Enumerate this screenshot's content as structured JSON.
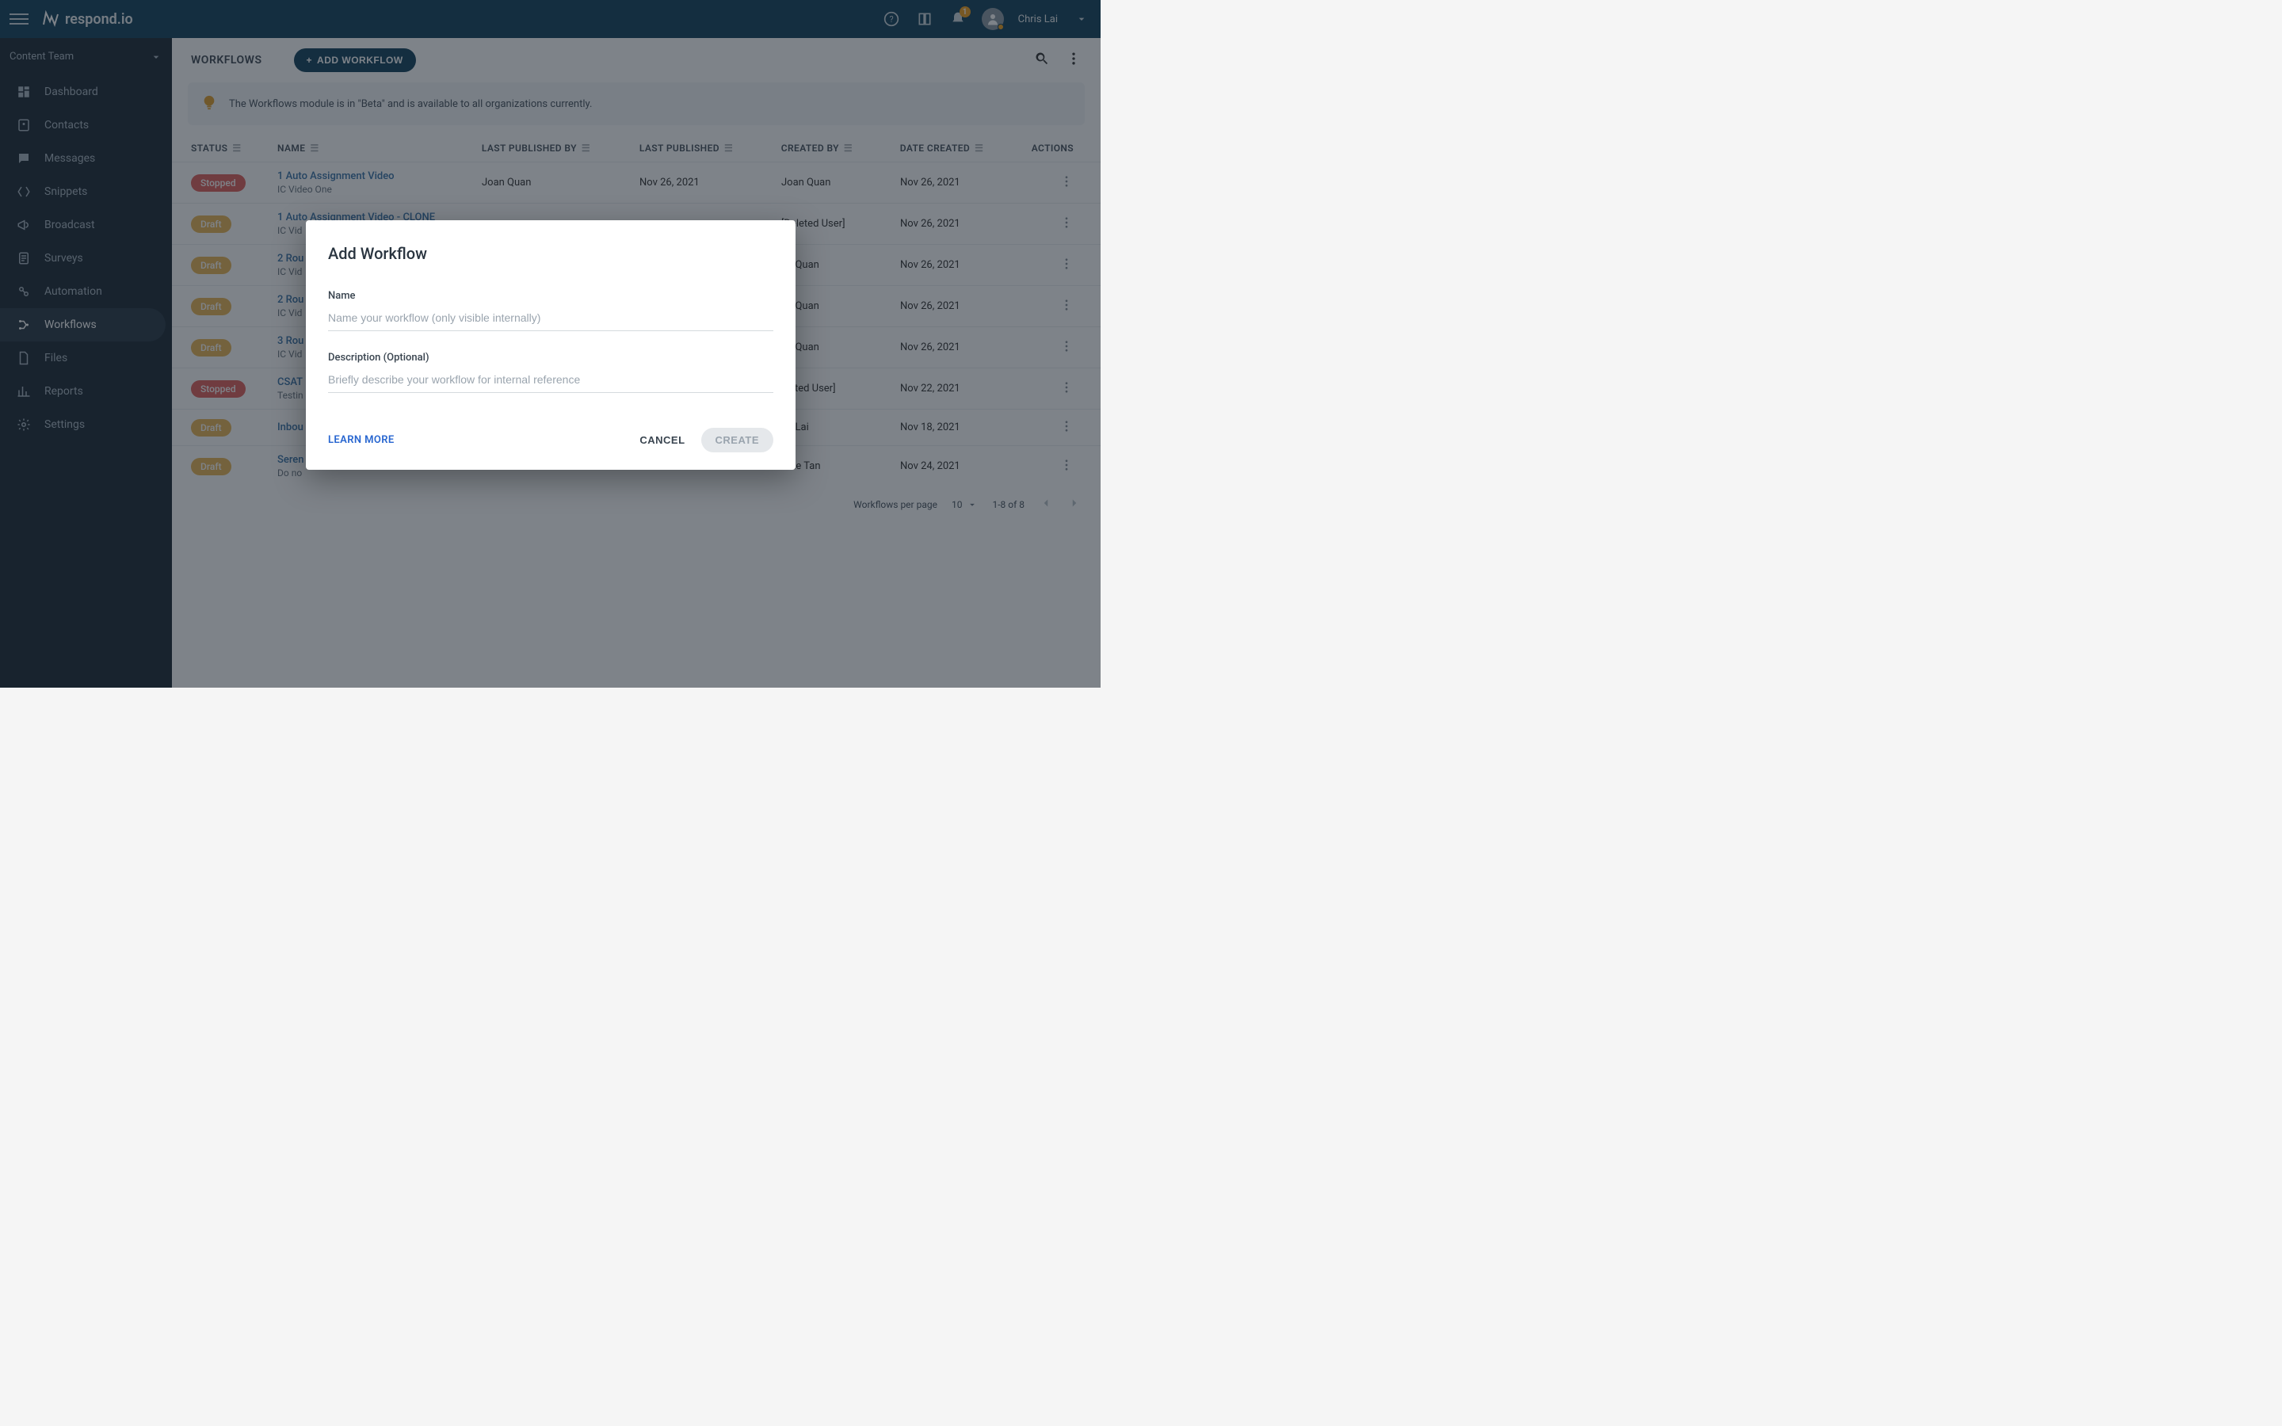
{
  "header": {
    "brand": "respond.io",
    "notif_count": "1",
    "username": "Chris Lai"
  },
  "sidebar": {
    "team": "Content Team",
    "items": [
      {
        "label": "Dashboard",
        "icon": "dashboard-icon"
      },
      {
        "label": "Contacts",
        "icon": "contacts-icon"
      },
      {
        "label": "Messages",
        "icon": "messages-icon"
      },
      {
        "label": "Snippets",
        "icon": "snippets-icon"
      },
      {
        "label": "Broadcast",
        "icon": "broadcast-icon"
      },
      {
        "label": "Surveys",
        "icon": "surveys-icon"
      },
      {
        "label": "Automation",
        "icon": "automation-icon"
      },
      {
        "label": "Workflows",
        "icon": "workflows-icon"
      },
      {
        "label": "Files",
        "icon": "files-icon"
      },
      {
        "label": "Reports",
        "icon": "reports-icon"
      },
      {
        "label": "Settings",
        "icon": "settings-icon"
      }
    ]
  },
  "page": {
    "title": "WORKFLOWS",
    "add_btn": "ADD WORKFLOW",
    "banner": "The Workflows module is in \"Beta\" and is available to all organizations currently."
  },
  "table": {
    "headers": {
      "status": "STATUS",
      "name": "NAME",
      "last_published_by": "LAST PUBLISHED BY",
      "last_published": "LAST PUBLISHED",
      "created_by": "CREATED BY",
      "date_created": "DATE CREATED",
      "actions": "ACTIONS"
    },
    "rows": [
      {
        "status": "Stopped",
        "status_class": "stopped",
        "name": "1 Auto Assignment Video",
        "sub": "IC Video One",
        "pub_by": "Joan Quan",
        "pub": "Nov 26, 2021",
        "created_by": "Joan Quan",
        "date_created": "Nov 26, 2021"
      },
      {
        "status": "Draft",
        "status_class": "draft",
        "name": "1 Auto Assignment Video - CLONE",
        "sub": "IC Vid",
        "pub_by": "",
        "pub": "",
        "created_by": "[Deleted User]",
        "date_created": "Nov 26, 2021"
      },
      {
        "status": "Draft",
        "status_class": "draft",
        "name": "2 Rou",
        "sub": "IC Vid",
        "pub_by": "",
        "pub": "",
        "created_by": "an Quan",
        "date_created": "Nov 26, 2021"
      },
      {
        "status": "Draft",
        "status_class": "draft",
        "name": "2 Rou",
        "sub": "IC Vid",
        "pub_by": "",
        "pub": "",
        "created_by": "an Quan",
        "date_created": "Nov 26, 2021"
      },
      {
        "status": "Draft",
        "status_class": "draft",
        "name": "3 Rou",
        "sub": "IC Vid",
        "pub_by": "",
        "pub": "",
        "created_by": "an Quan",
        "date_created": "Nov 26, 2021"
      },
      {
        "status": "Stopped",
        "status_class": "stopped",
        "name": "CSAT",
        "sub": "Testin",
        "pub_by": "",
        "pub": "",
        "created_by": "eleted User]",
        "date_created": "Nov 22, 2021"
      },
      {
        "status": "Draft",
        "status_class": "draft",
        "name": "Inbou",
        "sub": "",
        "pub_by": "",
        "pub": "",
        "created_by": "ris Lai",
        "date_created": "Nov 18, 2021"
      },
      {
        "status": "Draft",
        "status_class": "draft",
        "name": "Seren",
        "sub": "Do no",
        "pub_by": "",
        "pub": "",
        "created_by": "rene Tan",
        "date_created": "Nov 24, 2021"
      }
    ]
  },
  "pagination": {
    "label": "Workflows per page",
    "value": "10",
    "range": "1-8 of 8"
  },
  "modal": {
    "title": "Add Workflow",
    "name_label": "Name",
    "name_placeholder": "Name your workflow (only visible internally)",
    "desc_label": "Description (Optional)",
    "desc_placeholder": "Briefly describe your workflow for internal reference",
    "learn_more": "LEARN MORE",
    "cancel": "CANCEL",
    "create": "CREATE"
  }
}
